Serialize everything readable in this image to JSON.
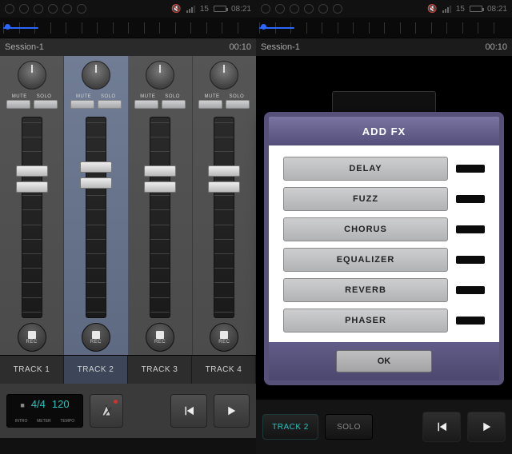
{
  "status": {
    "time": "08:21",
    "pct": "15"
  },
  "left": {
    "session_name": "Session-1",
    "session_time": "00:10",
    "progress_pct": 14,
    "mute_label": "MUTE",
    "solo_label": "SOLO",
    "rec_label": "REC",
    "selected_track_index": 1,
    "tracks": [
      {
        "label": "TRACK 1",
        "fader_pos_pct": 24
      },
      {
        "label": "TRACK 2",
        "fader_pos_pct": 22
      },
      {
        "label": "TRACK 3",
        "fader_pos_pct": 24
      },
      {
        "label": "TRACK 4",
        "fader_pos_pct": 24
      }
    ],
    "meter": {
      "time_sig": "4/4",
      "tempo": "120",
      "legend_intro": "INTRO",
      "legend_meter": "METER",
      "legend_tempo": "TEMPO"
    }
  },
  "right": {
    "session_name": "Session-1",
    "session_time": "00:10",
    "progress_pct": 14,
    "modal": {
      "title": "ADD FX",
      "items": [
        {
          "label": "DELAY"
        },
        {
          "label": "FUZZ"
        },
        {
          "label": "CHORUS"
        },
        {
          "label": "EQUALIZER"
        },
        {
          "label": "REVERB"
        },
        {
          "label": "PHASER"
        }
      ],
      "ok_label": "OK"
    },
    "bottom": {
      "track_label": "TRACK 2",
      "solo_label": "SOLO"
    }
  }
}
